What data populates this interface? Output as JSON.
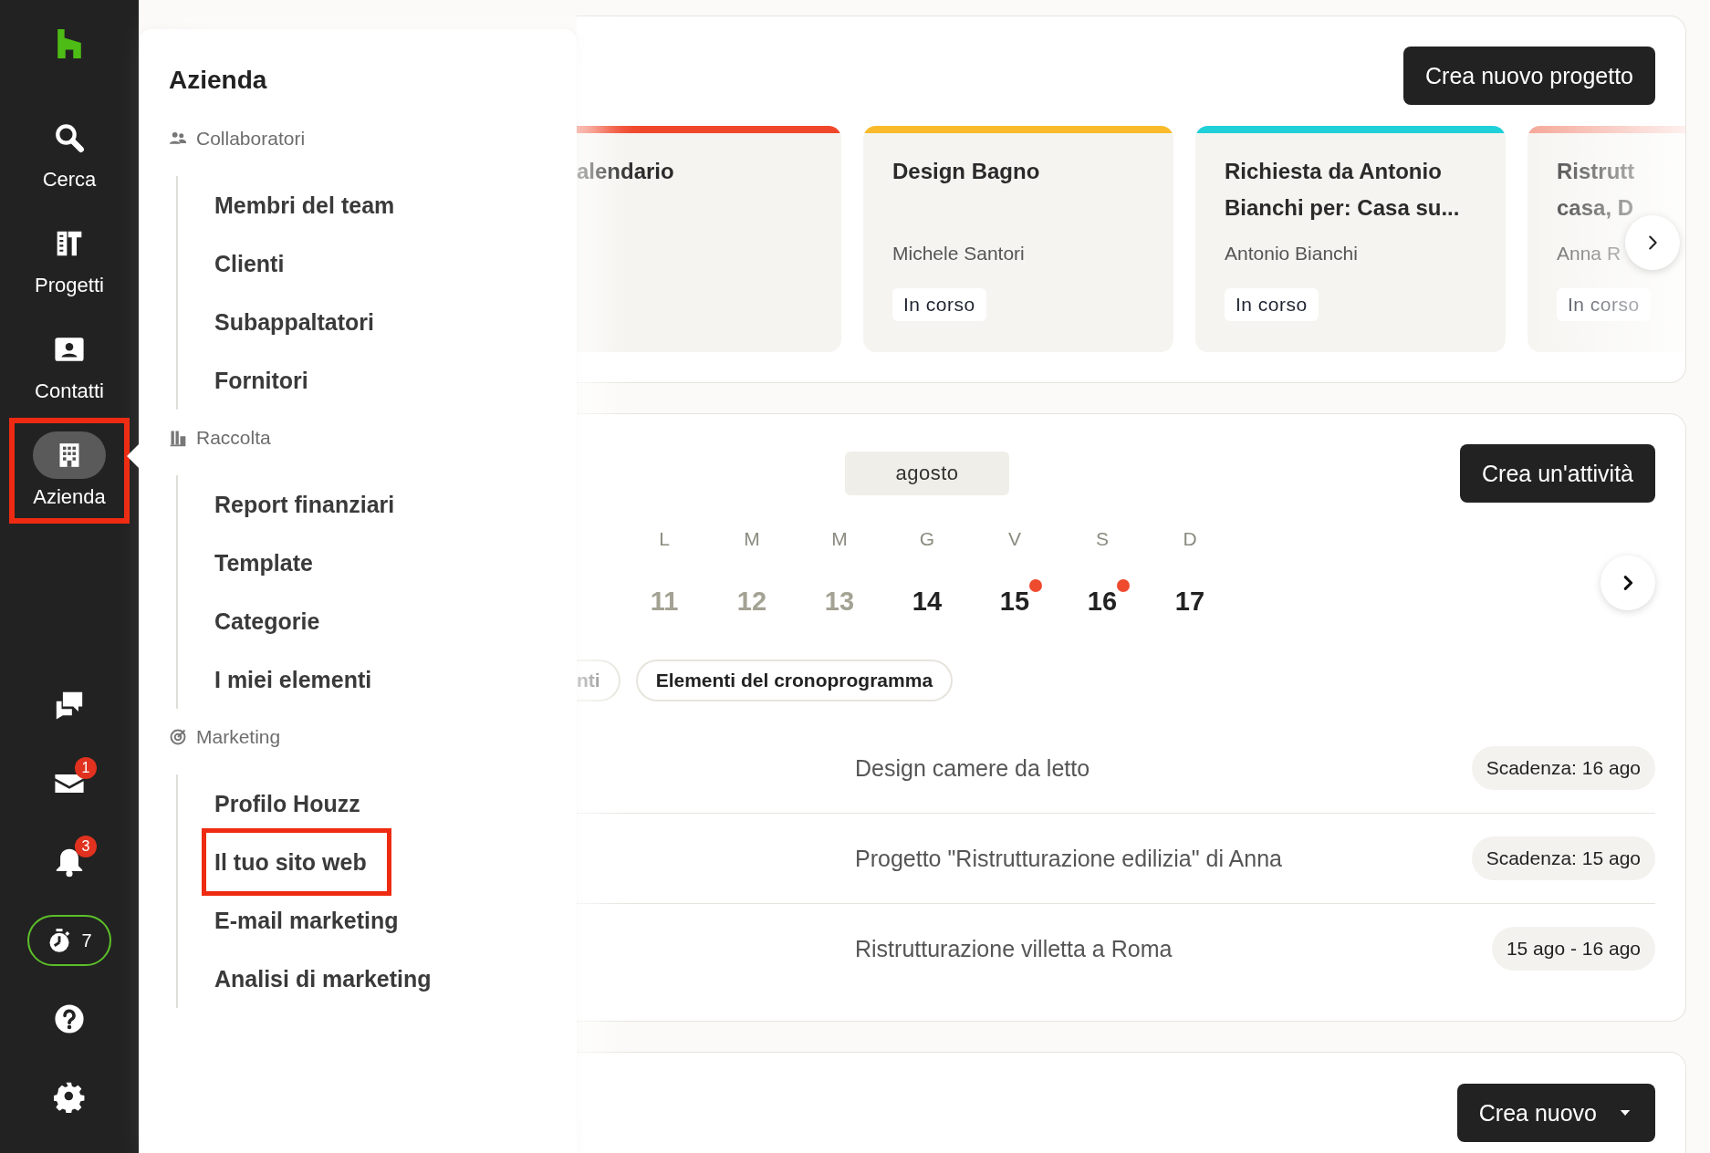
{
  "sidebar": {
    "nav": [
      {
        "label": "Cerca",
        "selected": false,
        "highlighted": false
      },
      {
        "label": "Progetti",
        "selected": false,
        "highlighted": false
      },
      {
        "label": "Contatti",
        "selected": false,
        "highlighted": false
      },
      {
        "label": "Azienda",
        "selected": true,
        "highlighted": true
      }
    ],
    "mail_badge": "1",
    "notifications_badge": "3",
    "timer_count": "7"
  },
  "menu": {
    "title": "Azienda",
    "groups": [
      {
        "label": "Collaboratori",
        "items": [
          {
            "label": "Membri del team",
            "highlighted": false
          },
          {
            "label": "Clienti",
            "highlighted": false
          },
          {
            "label": "Subappaltatori",
            "highlighted": false
          },
          {
            "label": "Fornitori",
            "highlighted": false
          }
        ]
      },
      {
        "label": "Raccolta",
        "items": [
          {
            "label": "Report finanziari",
            "highlighted": false
          },
          {
            "label": "Template",
            "highlighted": false
          },
          {
            "label": "Categorie",
            "highlighted": false
          },
          {
            "label": "I miei elementi",
            "highlighted": false
          }
        ]
      },
      {
        "label": "Marketing",
        "items": [
          {
            "label": "Profilo Houzz",
            "highlighted": false
          },
          {
            "label": "Il tuo sito web",
            "highlighted": true
          },
          {
            "label": "E-mail marketing",
            "highlighted": false
          },
          {
            "label": "Analisi di marketing",
            "highlighted": false
          }
        ]
      }
    ]
  },
  "projects": {
    "create_button": "Crea nuovo progetto",
    "cards": [
      {
        "title": "alendario",
        "color": "#f0472b"
      },
      {
        "title": "Design Bagno",
        "client": "Michele Santori",
        "status": "In corso",
        "color": "#f9bb2b"
      },
      {
        "title": "Richiesta da Antonio\nBianchi per: Casa su...",
        "client": "Antonio Bianchi",
        "status": "In corso",
        "color": "#1fd0d8"
      },
      {
        "title": "Ristrutt\ncasa, D",
        "client": "Anna R",
        "status": "In corso",
        "color": "#f4a090"
      }
    ]
  },
  "calendar": {
    "month": "agosto",
    "create_button": "Crea un'attività",
    "weekdays": [
      "L",
      "M",
      "M",
      "G",
      "V",
      "S",
      "D"
    ],
    "days": [
      {
        "number": "11",
        "past": true,
        "has_event": false
      },
      {
        "number": "12",
        "past": true,
        "has_event": false
      },
      {
        "number": "13",
        "past": true,
        "has_event": false
      },
      {
        "number": "14",
        "past": false,
        "has_event": false
      },
      {
        "number": "15",
        "past": false,
        "has_event": true
      },
      {
        "number": "16",
        "past": false,
        "has_event": true
      },
      {
        "number": "17",
        "past": false,
        "has_event": false
      }
    ],
    "filters": [
      {
        "label": "nti"
      },
      {
        "label": "Elementi del cronoprogramma"
      }
    ],
    "tasks": [
      {
        "title": "Design camere da letto",
        "due": "Scadenza: 16 ago"
      },
      {
        "title": "Progetto \"Ristrutturazione edilizia\" di Anna",
        "due": "Scadenza: 15 ago"
      },
      {
        "title": "Ristrutturazione villetta a Roma",
        "due": "15 ago - 16 ago"
      }
    ]
  },
  "third_section": {
    "create_button": "Crea nuovo"
  }
}
